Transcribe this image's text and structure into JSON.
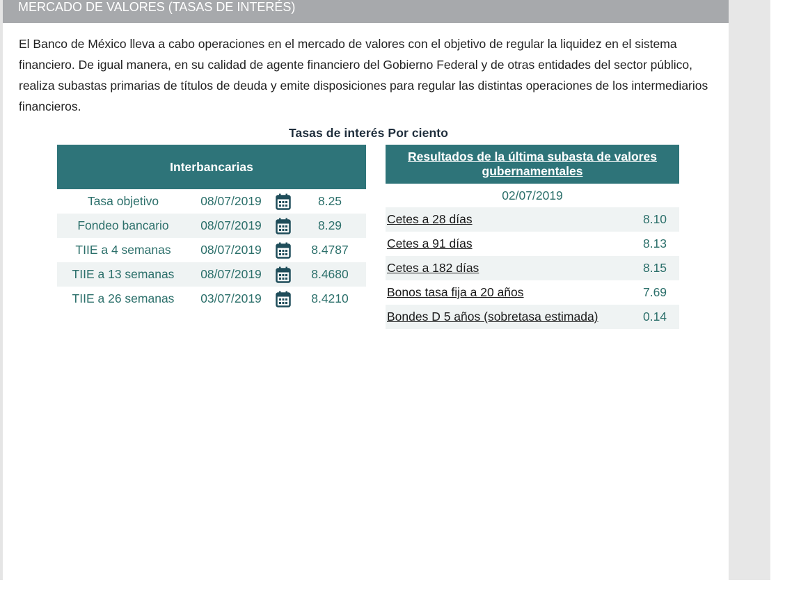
{
  "header": {
    "title": "MERCADO DE VALORES (TASAS DE INTERÉS)"
  },
  "intro": "El Banco de México lleva a cabo operaciones en el mercado de valores con el objetivo de regular la liquidez en el sistema financiero. De igual manera, en su calidad de agente financiero del Gobierno Federal y de otras entidades del sector público, realiza subastas primarias de títulos de deuda y emite disposiciones para regular las distintas operaciones de los intermediarios financieros.",
  "tables_title": "Tasas de interés Por ciento",
  "interbancarias": {
    "header": "Interbancarias",
    "rows": [
      {
        "name": "Tasa objetivo",
        "date": "08/07/2019",
        "value": "8.25",
        "icon": "calendar-icon"
      },
      {
        "name": "Fondeo bancario",
        "date": "08/07/2019",
        "value": "8.29",
        "icon": "calendar-icon"
      },
      {
        "name": "TIIE a 4 semanas",
        "date": "08/07/2019",
        "value": "8.4787",
        "icon": "calendar-icon"
      },
      {
        "name": "TIIE a 13 semanas",
        "date": "08/07/2019",
        "value": "8.4680",
        "icon": "calendar-icon"
      },
      {
        "name": "TIIE a 26 semanas",
        "date": "03/07/2019",
        "value": "8.4210",
        "icon": "calendar-icon"
      }
    ]
  },
  "subasta": {
    "header": "Resultados de la última subasta de valores gubernamentales",
    "date": "02/07/2019",
    "rows": [
      {
        "name": "Cetes a 28 días",
        "value": "8.10"
      },
      {
        "name": "Cetes a 91 días",
        "value": "8.13"
      },
      {
        "name": "Cetes a 182 días",
        "value": "8.15"
      },
      {
        "name": "Bonos tasa fija a 20 años",
        "value": "7.69"
      },
      {
        "name": "Bondes D 5 años (sobretasa estimada)",
        "value": "0.14"
      }
    ]
  },
  "colors": {
    "header_gray": "#a7a9ac",
    "table_header": "#2e7479",
    "value_text": "#2b6f6a",
    "row_shade": "#eff3f3",
    "calendar_icon": "#1f4d5a"
  }
}
